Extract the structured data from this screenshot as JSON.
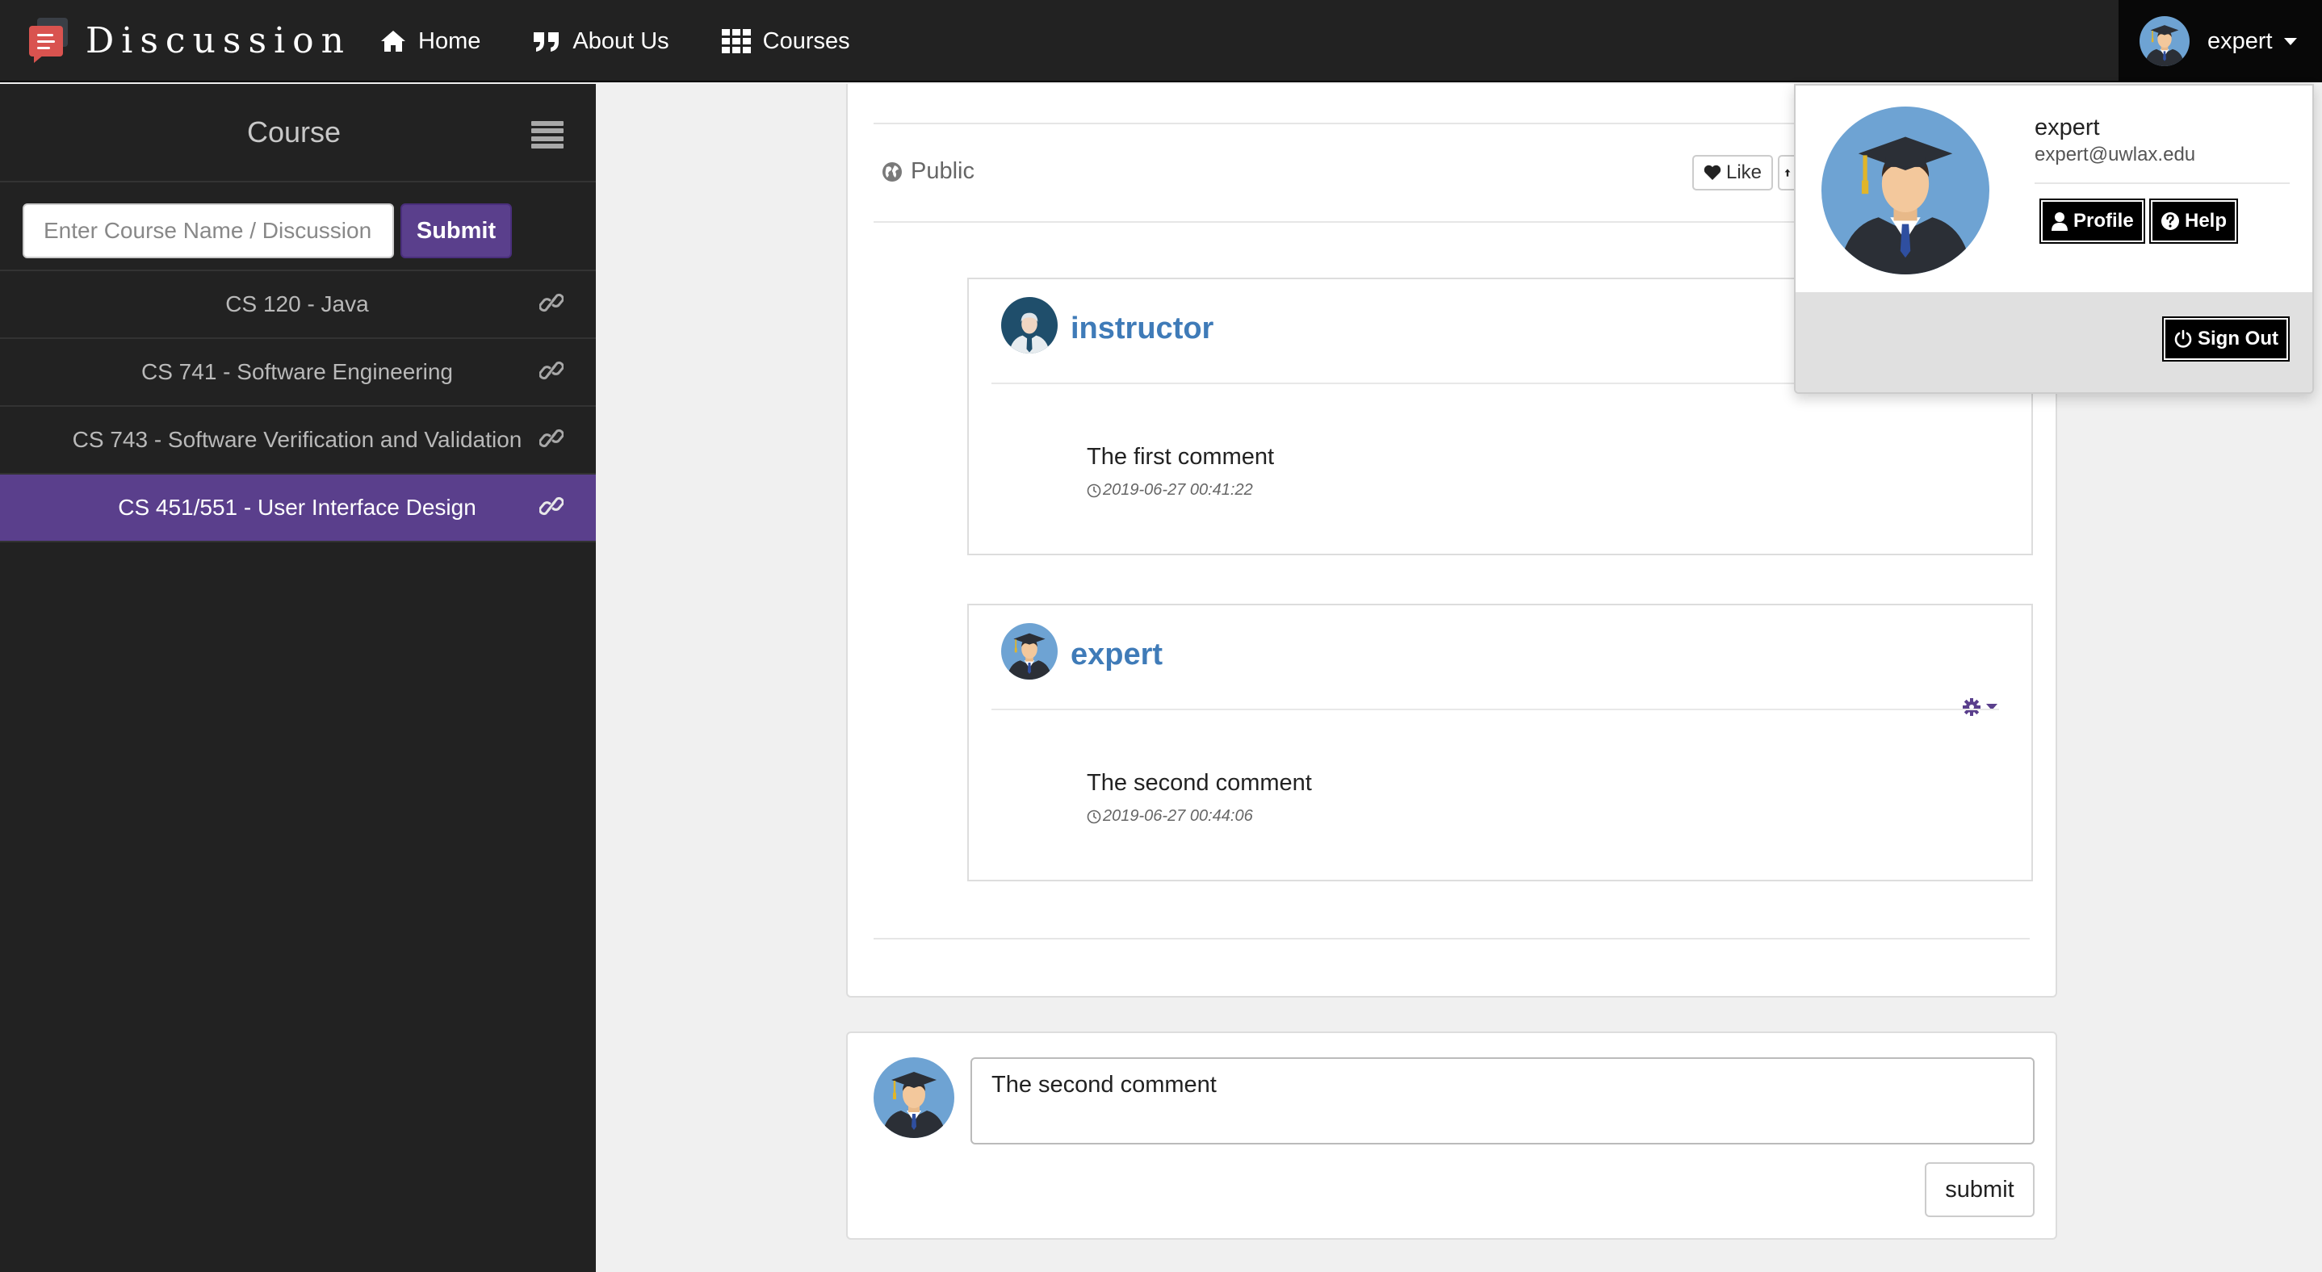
{
  "navbar": {
    "brand": "Discussion",
    "items": [
      {
        "label": "Home",
        "icon": "home-icon"
      },
      {
        "label": "About Us",
        "icon": "quote-icon"
      },
      {
        "label": "Courses",
        "icon": "grid-icon"
      }
    ],
    "user": "expert"
  },
  "sidebar": {
    "title": "Course",
    "search_placeholder": "Enter Course Name / Discussion",
    "submit_label": "Submit",
    "courses": [
      {
        "label": "CS 120 - Java",
        "active": false
      },
      {
        "label": "CS 741 - Software Engineering",
        "active": false
      },
      {
        "label": "CS 743 - Software Verification and Validation",
        "active": false
      },
      {
        "label": "CS 451/551 - User Interface Design",
        "active": true
      }
    ]
  },
  "post": {
    "visibility": "Public",
    "like_label": "Like"
  },
  "comments": [
    {
      "author": "instructor",
      "text": "The first comment",
      "time": "2019-06-27 00:41:22"
    },
    {
      "author": "expert",
      "text": "The second comment",
      "time": "2019-06-27 00:44:06"
    }
  ],
  "reply": {
    "value": "The second comment",
    "submit_label": "submit"
  },
  "user_dropdown": {
    "name": "expert",
    "email": "expert@uwlax.edu",
    "profile_label": "Profile",
    "help_label": "Help",
    "signout_label": "Sign Out"
  },
  "colors": {
    "navbar": "#222222",
    "accent_purple": "#5a3f8c",
    "author_blue": "#3f7bb8",
    "brand_red": "#d9534f"
  }
}
